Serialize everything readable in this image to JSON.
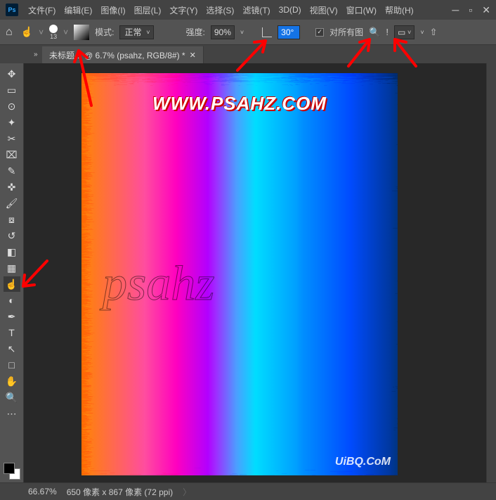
{
  "menubar": {
    "items": [
      "文件(F)",
      "编辑(E)",
      "图像(I)",
      "图层(L)",
      "文字(Y)",
      "选择(S)",
      "滤镜(T)",
      "3D(D)",
      "视图(V)",
      "窗口(W)",
      "帮助(H)"
    ]
  },
  "options": {
    "brush_size": "13",
    "mode_label": "模式:",
    "mode_value": "正常",
    "strength_label": "强度:",
    "strength_value": "90%",
    "angle_value": "30°",
    "all_layers_label": "对所有图",
    "sample_all_checked": true
  },
  "tab": {
    "title": "未标题-1 @ 6.7% (psahz, RGB/8#) *"
  },
  "tools": [
    {
      "name": "move",
      "glyph": "✥"
    },
    {
      "name": "marquee",
      "glyph": "▭"
    },
    {
      "name": "lasso",
      "glyph": "⊙"
    },
    {
      "name": "magic-wand",
      "glyph": "✦"
    },
    {
      "name": "crop",
      "glyph": "✂"
    },
    {
      "name": "frame",
      "glyph": "⌧"
    },
    {
      "name": "eyedropper",
      "glyph": "✎"
    },
    {
      "name": "healing",
      "glyph": "✜"
    },
    {
      "name": "brush",
      "glyph": "🖌"
    },
    {
      "name": "stamp",
      "glyph": "⧇"
    },
    {
      "name": "history-brush",
      "glyph": "↺"
    },
    {
      "name": "eraser",
      "glyph": "◧"
    },
    {
      "name": "gradient",
      "glyph": "▦"
    },
    {
      "name": "smudge",
      "glyph": "☝",
      "active": true
    },
    {
      "name": "dodge",
      "glyph": "◐"
    },
    {
      "name": "pen",
      "glyph": "✒"
    },
    {
      "name": "type",
      "glyph": "T"
    },
    {
      "name": "path-select",
      "glyph": "↖"
    },
    {
      "name": "rectangle",
      "glyph": "□"
    },
    {
      "name": "hand",
      "glyph": "✋"
    },
    {
      "name": "zoom",
      "glyph": "🔍"
    },
    {
      "name": "edit-toolbar",
      "glyph": "⋯"
    }
  ],
  "canvas": {
    "watermark": "WWW.PSAHZ.COM",
    "corner": "UiBQ.CoM",
    "path_text": "psahz"
  },
  "status": {
    "zoom": "66.67%",
    "dimensions": "650 像素 x 867 像素 (72 ppi)"
  }
}
